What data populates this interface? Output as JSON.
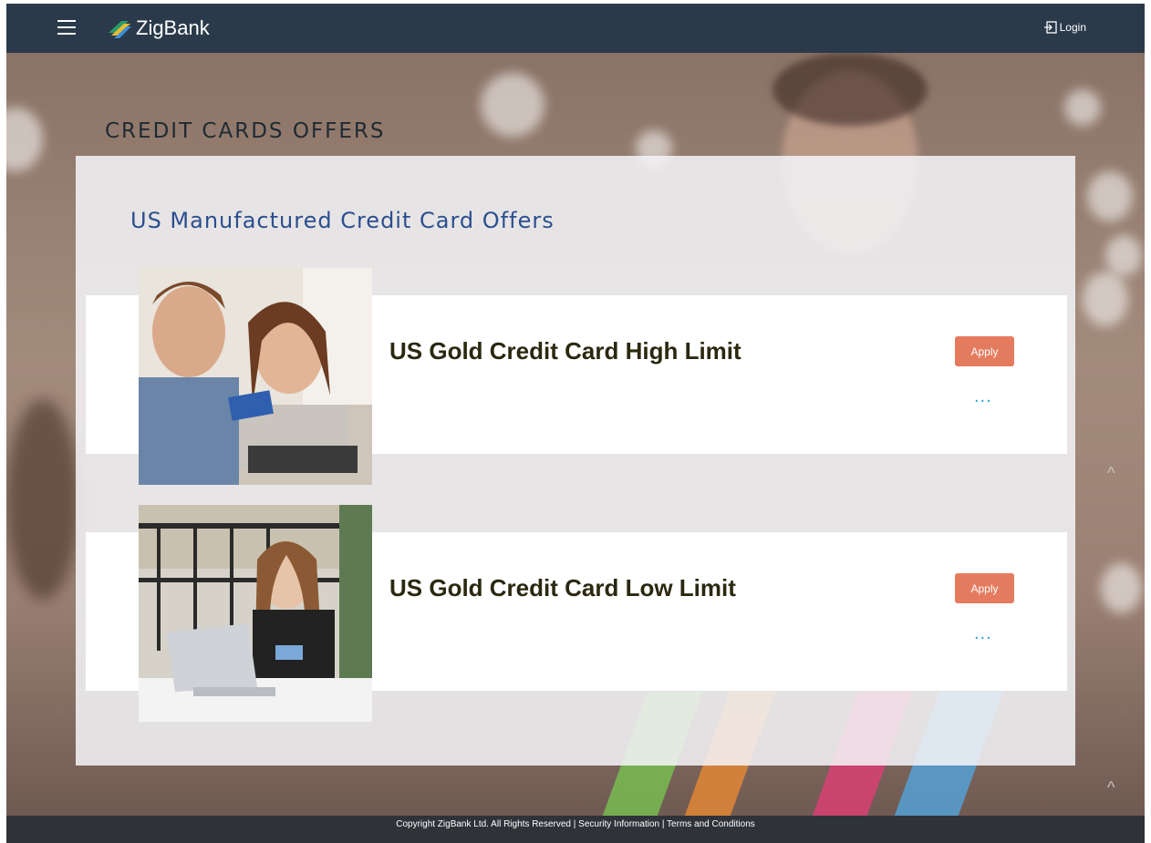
{
  "header": {
    "brand": "ZigBank",
    "login_label": "Login"
  },
  "page": {
    "title": "CREDIT CARDS OFFERS"
  },
  "section": {
    "title": "US Manufactured Credit Card Offers"
  },
  "offers": [
    {
      "name": "US Gold Credit Card High Limit",
      "apply_label": "Apply",
      "more_label": "..."
    },
    {
      "name": "US Gold Credit Card Low Limit",
      "apply_label": "Apply",
      "more_label": "..."
    }
  ],
  "footer": {
    "text": "Copyright ZigBank Ltd. All Rights Reserved | Security Information | Terms and Conditions"
  },
  "icons": {
    "menu": "hamburger-icon",
    "logo": "zigbank-logo-icon",
    "login": "login-icon",
    "more": "more-dots-icon",
    "scroll_up": "chevron-up-icon"
  },
  "colors": {
    "topbar": "#2a3a4a",
    "section_title": "#2a4f8f",
    "apply_button": "#e47b5e",
    "more_dots": "#2fa4d8",
    "footer": "#2f3338"
  }
}
